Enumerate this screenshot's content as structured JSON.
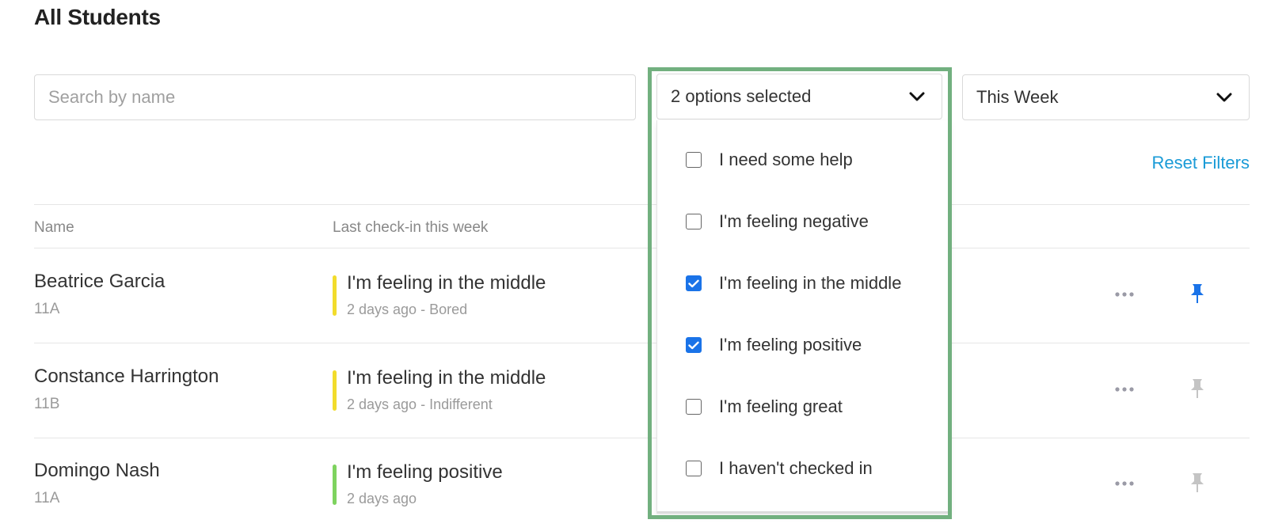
{
  "page": {
    "title": "All Students"
  },
  "filters": {
    "search_placeholder": "Search by name",
    "status_select": {
      "value": "2 options selected"
    },
    "period_select": {
      "value": "This Week"
    },
    "reset_label": "Reset Filters"
  },
  "table": {
    "columns": [
      "Name",
      "Last check-in this week"
    ],
    "rows": [
      {
        "name": "Beatrice Garcia",
        "class": "11A",
        "mood": "I'm feeling in the middle",
        "meta": "2 days ago - Bored",
        "mood_color": "#f2dc2c",
        "pinned": true
      },
      {
        "name": "Constance Harrington",
        "class": "11B",
        "mood": "I'm feeling in the middle",
        "meta": "2 days ago - Indifferent",
        "mood_color": "#f2dc2c",
        "pinned": false
      },
      {
        "name": "Domingo Nash",
        "class": "11A",
        "mood": "I'm feeling positive",
        "meta": "2 days ago",
        "mood_color": "#7ed35f",
        "pinned": false
      }
    ]
  },
  "dropdown": {
    "options": [
      {
        "label": "I need some help",
        "checked": false
      },
      {
        "label": "I'm feeling negative",
        "checked": false
      },
      {
        "label": "I'm feeling in the middle",
        "checked": true
      },
      {
        "label": "I'm feeling positive",
        "checked": true
      },
      {
        "label": "I'm feeling great",
        "checked": false
      },
      {
        "label": "I haven't checked in",
        "checked": false
      }
    ]
  },
  "colors": {
    "accent_link": "#1a9bd7",
    "checkbox_checked": "#1a73e8",
    "pin_active": "#1a73e8",
    "pin_inactive": "#c4c4c4",
    "highlight_frame": "#72b07f"
  },
  "icons": {
    "chevron": "chevron-down-icon",
    "more": "more-horizontal-icon",
    "pin": "pin-icon",
    "check": "checkmark-icon"
  }
}
